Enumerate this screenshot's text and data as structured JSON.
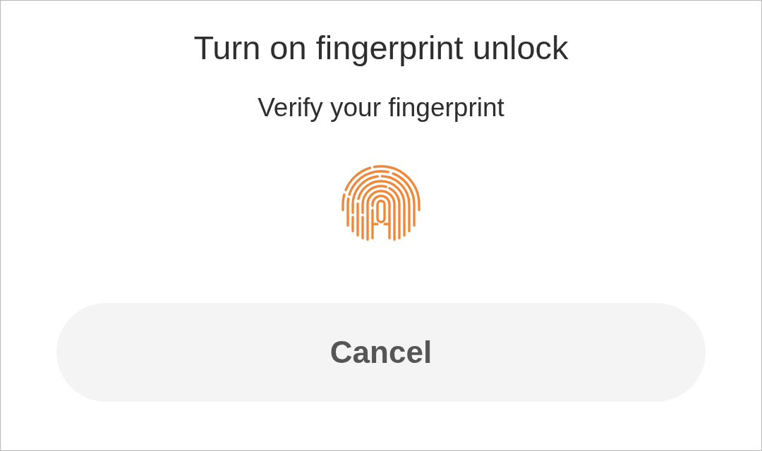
{
  "dialog": {
    "title": "Turn on fingerprint unlock",
    "subtitle": "Verify your fingerprint",
    "cancel_button": "Cancel"
  }
}
